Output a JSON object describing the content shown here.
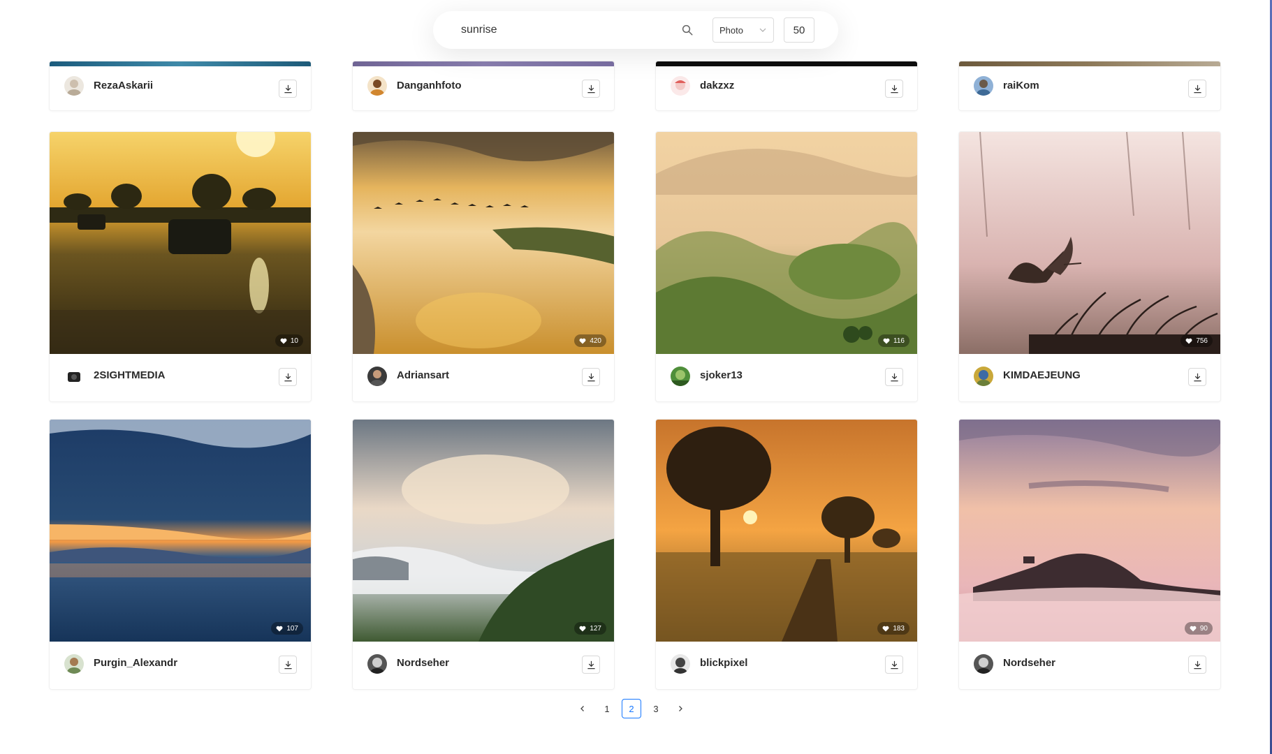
{
  "search": {
    "query": "sunrise",
    "placeholder": "",
    "type_selected": "Photo",
    "per_page": "50"
  },
  "photos_row1": [
    {
      "author": "RezaAskarii"
    },
    {
      "author": "Danganhfoto"
    },
    {
      "author": "dakzxz"
    },
    {
      "author": "raiKom"
    }
  ],
  "photos_row2": [
    {
      "author": "2SIGHTMEDIA",
      "likes": "10"
    },
    {
      "author": "Adriansart",
      "likes": "420"
    },
    {
      "author": "sjoker13",
      "likes": "116"
    },
    {
      "author": "KIMDAEJEUNG",
      "likes": "756"
    }
  ],
  "photos_row3": [
    {
      "author": "Purgin_Alexandr",
      "likes": "107"
    },
    {
      "author": "Nordseher",
      "likes": "127"
    },
    {
      "author": "blickpixel",
      "likes": "183"
    },
    {
      "author": "Nordseher",
      "likes": "90"
    }
  ],
  "pagination": {
    "pages": [
      "1",
      "2",
      "3"
    ],
    "current": "2"
  },
  "icons": {
    "search": "search-icon",
    "dropdown": "chevron-down-icon",
    "download": "download-icon",
    "like": "heart-icon",
    "prev": "chevron-left-icon",
    "next": "chevron-right-icon"
  },
  "colors": {
    "accent": "#1677ff",
    "edge": "#4a5ea6"
  }
}
